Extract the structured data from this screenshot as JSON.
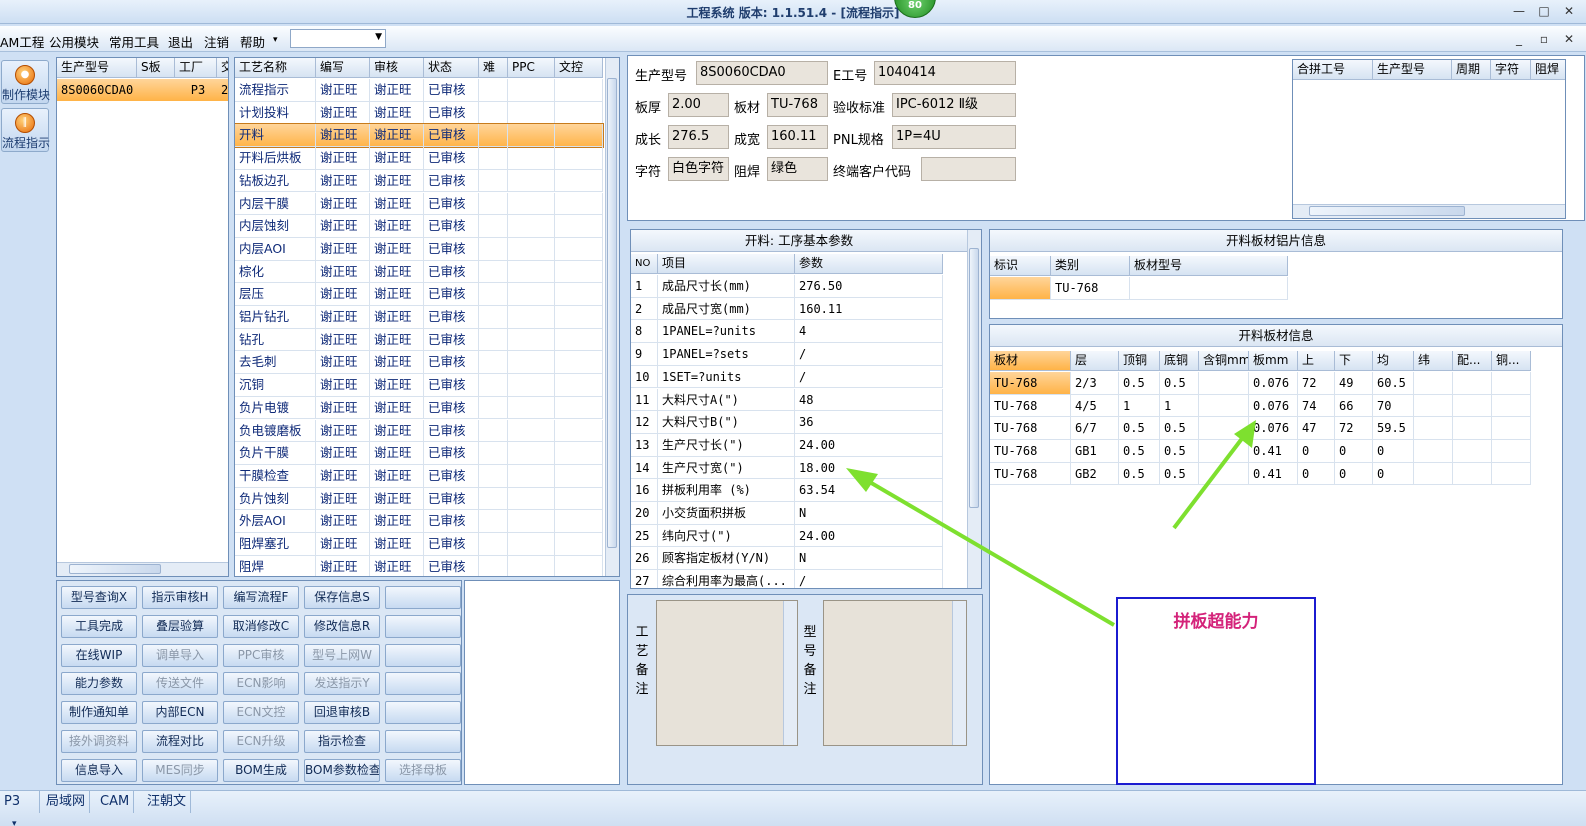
{
  "window": {
    "title": "工程系统  版本: 1.1.51.4 - [流程指示]",
    "badge": "80"
  },
  "menu": {
    "items": [
      "AM工程",
      "公用模块",
      "常用工具",
      "退出",
      "注销",
      "帮助"
    ],
    "help_arrow": "▾",
    "combo_value": ""
  },
  "sidebar": {
    "buttons": [
      {
        "label": "制作模块"
      },
      {
        "label": "流程指示"
      }
    ]
  },
  "model_grid": {
    "headers": [
      "生产型号",
      "S板",
      "工厂",
      "交"
    ],
    "rows": [
      [
        "8S0060CDA0",
        "",
        "P3",
        "2"
      ]
    ]
  },
  "process_grid": {
    "headers": [
      "工艺名称",
      "编写",
      "审核",
      "状态",
      "难",
      "PPC",
      "文控"
    ],
    "rows": [
      [
        "流程指示",
        "谢正旺",
        "谢正旺",
        "已审核"
      ],
      [
        "计划投料",
        "谢正旺",
        "谢正旺",
        "已审核"
      ],
      [
        "开料",
        "谢正旺",
        "谢正旺",
        "已审核"
      ],
      [
        "开料后烘板",
        "谢正旺",
        "谢正旺",
        "已审核"
      ],
      [
        "钻板边孔",
        "谢正旺",
        "谢正旺",
        "已审核"
      ],
      [
        "内层干膜",
        "谢正旺",
        "谢正旺",
        "已审核"
      ],
      [
        "内层蚀刻",
        "谢正旺",
        "谢正旺",
        "已审核"
      ],
      [
        "内层AOI",
        "谢正旺",
        "谢正旺",
        "已审核"
      ],
      [
        "棕化",
        "谢正旺",
        "谢正旺",
        "已审核"
      ],
      [
        "层压",
        "谢正旺",
        "谢正旺",
        "已审核"
      ],
      [
        "铝片钻孔",
        "谢正旺",
        "谢正旺",
        "已审核"
      ],
      [
        "钻孔",
        "谢正旺",
        "谢正旺",
        "已审核"
      ],
      [
        "去毛刺",
        "谢正旺",
        "谢正旺",
        "已审核"
      ],
      [
        "沉铜",
        "谢正旺",
        "谢正旺",
        "已审核"
      ],
      [
        "负片电镀",
        "谢正旺",
        "谢正旺",
        "已审核"
      ],
      [
        "负电镀磨板",
        "谢正旺",
        "谢正旺",
        "已审核"
      ],
      [
        "负片干膜",
        "谢正旺",
        "谢正旺",
        "已审核"
      ],
      [
        "干膜检查",
        "谢正旺",
        "谢正旺",
        "已审核"
      ],
      [
        "负片蚀刻",
        "谢正旺",
        "谢正旺",
        "已审核"
      ],
      [
        "外层AOI",
        "谢正旺",
        "谢正旺",
        "已审核"
      ],
      [
        "阻焊塞孔",
        "谢正旺",
        "谢正旺",
        "已审核"
      ],
      [
        "阻焊",
        "谢正旺",
        "谢正旺",
        "已审核"
      ]
    ],
    "selected_index": 2
  },
  "action_buttons": [
    [
      "型号查询X",
      "指示审核H",
      "编写流程F",
      "保存信息S",
      ""
    ],
    [
      "工具完成",
      "叠层验算",
      "取消修改C",
      "修改信息R",
      ""
    ],
    [
      "在线WIP",
      "调单导入",
      "PPC审核",
      "型号上网W",
      ""
    ],
    [
      "能力参数",
      "传送文件",
      "ECN影响",
      "发送指示Y",
      ""
    ],
    [
      "制作通知单",
      "内部ECN",
      "ECN文控",
      "回退审核B",
      ""
    ],
    [
      "接外调资料",
      "流程对比",
      "ECN升级",
      "指示检查",
      ""
    ],
    [
      "信息导入",
      "MES同步",
      "BOM生成",
      "BOM参数检查",
      "选择母板"
    ]
  ],
  "info": {
    "model_label": "生产型号",
    "model": "8S0060CDA0",
    "e_label": "E工号",
    "e_no": "1040414",
    "thickness_label": "板厚",
    "thickness": "2.00",
    "material_label": "板材",
    "material": "TU-768",
    "standard_label": "验收标准",
    "standard": "IPC-6012 Ⅱ级",
    "length_label": "成长",
    "length": "276.5",
    "width_label": "成宽",
    "width": "160.11",
    "pnl_label": "PNL规格",
    "pnl": "1P=4U",
    "legend_label": "字符",
    "legend": "白色字符",
    "mask_label": "阻焊",
    "mask": "绿色",
    "customer_label": "终端客户代码",
    "customer": ""
  },
  "merge_grid": {
    "headers": [
      "合拼工号",
      "生产型号",
      "周期",
      "字符",
      "阻焊"
    ]
  },
  "params": {
    "title": "开料: 工序基本参数",
    "headers": [
      "NO",
      "项目",
      "参数"
    ],
    "rows": [
      [
        "1",
        "成品尺寸长(mm)",
        "276.50"
      ],
      [
        "2",
        "成品尺寸宽(mm)",
        "160.11"
      ],
      [
        "8",
        "1PANEL=?units",
        "4"
      ],
      [
        "9",
        "1PANEL=?sets",
        "/"
      ],
      [
        "10",
        "1SET=?units",
        "/"
      ],
      [
        "11",
        "大料尺寸A(\")",
        "48"
      ],
      [
        "12",
        "大料尺寸B(\")",
        "36"
      ],
      [
        "13",
        "生产尺寸长(\")",
        "24.00"
      ],
      [
        "14",
        "生产尺寸宽(\")",
        "18.00"
      ],
      [
        "16",
        "拼板利用率 (%)",
        "63.54"
      ],
      [
        "20",
        "小交货面积拼板",
        "N"
      ],
      [
        "25",
        "纬向尺寸(\")",
        "24.00"
      ],
      [
        "26",
        "顾客指定板材(Y/N)",
        "N"
      ],
      [
        "27",
        "综合利用率为最高(...",
        "/"
      ]
    ]
  },
  "aluminum": {
    "title": "开料板材铝片信息",
    "headers": [
      "标识",
      "类别",
      "板材型号"
    ],
    "rows": [
      [
        "",
        "TU-768",
        ""
      ]
    ]
  },
  "sheet": {
    "title": "开料板材信息",
    "headers": [
      "板材",
      "层",
      "顶铜",
      "底铜",
      "含铜mm",
      "板mm",
      "上",
      "下",
      "均",
      "纬",
      "配...",
      "铜..."
    ],
    "rows": [
      [
        "TU-768",
        "2/3",
        "0.5",
        "0.5",
        "",
        "0.076",
        "72",
        "49",
        "60.5",
        "",
        "",
        ""
      ],
      [
        "TU-768",
        "4/5",
        "1",
        "1",
        "",
        "0.076",
        "74",
        "66",
        "70",
        "",
        "",
        ""
      ],
      [
        "TU-768",
        "6/7",
        "0.5",
        "0.5",
        "",
        "0.076",
        "47",
        "72",
        "59.5",
        "",
        "",
        ""
      ],
      [
        "TU-768",
        "GB1",
        "0.5",
        "0.5",
        "",
        "0.41",
        "0",
        "0",
        "0",
        "",
        "",
        ""
      ],
      [
        "TU-768",
        "GB2",
        "0.5",
        "0.5",
        "",
        "0.41",
        "0",
        "0",
        "0",
        "",
        "",
        ""
      ]
    ]
  },
  "memo": {
    "process_label": "工艺备注",
    "model_label": "型号备注"
  },
  "annotation": {
    "text": "拼板超能力",
    "color": "#d4237a",
    "arrow_color": "#7ee02f"
  },
  "status": {
    "items": [
      "P3",
      "局域网",
      "CAM",
      "汪朝文"
    ],
    "arrow": "▾"
  }
}
